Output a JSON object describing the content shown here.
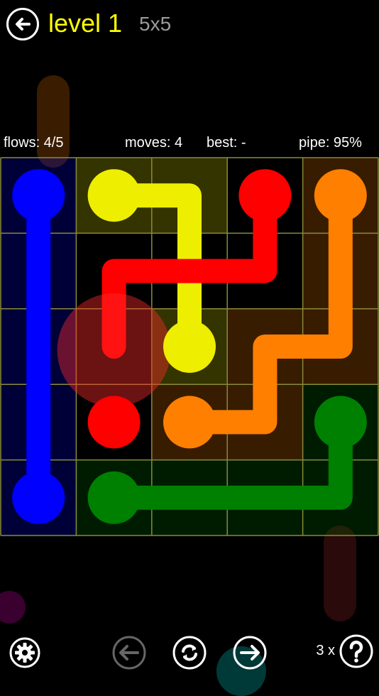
{
  "header": {
    "title": "level 1",
    "grid_size": "5x5"
  },
  "stats": {
    "flows": "flows: 4/5",
    "moves": "moves: 4",
    "best": "best: -",
    "pipe": "pipe: 95%"
  },
  "footer": {
    "hint_count": "3 x"
  },
  "colors": {
    "blue": "#0000ff",
    "yellow": "#eeee00",
    "red": "#ff0000",
    "orange": "#ff7f00",
    "green": "#008000",
    "grid_line": "#8a8a3a"
  },
  "board": {
    "rows": 5,
    "cols": 5,
    "endpoints": [
      {
        "color": "blue",
        "row": 0,
        "col": 0
      },
      {
        "color": "blue",
        "row": 4,
        "col": 0
      },
      {
        "color": "yellow",
        "row": 0,
        "col": 1
      },
      {
        "color": "yellow",
        "row": 2,
        "col": 2
      },
      {
        "color": "red",
        "row": 0,
        "col": 3
      },
      {
        "color": "red",
        "row": 3,
        "col": 1
      },
      {
        "color": "orange",
        "row": 0,
        "col": 4
      },
      {
        "color": "orange",
        "row": 3,
        "col": 2
      },
      {
        "color": "green",
        "row": 3,
        "col": 4
      },
      {
        "color": "green",
        "row": 4,
        "col": 1
      }
    ],
    "paths": [
      {
        "color": "blue",
        "cells": [
          [
            0,
            0
          ],
          [
            1,
            0
          ],
          [
            2,
            0
          ],
          [
            3,
            0
          ],
          [
            4,
            0
          ]
        ]
      },
      {
        "color": "yellow",
        "cells": [
          [
            0,
            1
          ],
          [
            0,
            2
          ],
          [
            1,
            2
          ],
          [
            2,
            2
          ]
        ]
      },
      {
        "color": "red",
        "cells": [
          [
            0,
            3
          ],
          [
            1,
            3
          ],
          [
            1,
            2
          ],
          [
            1,
            1
          ],
          [
            2,
            1
          ]
        ]
      },
      {
        "color": "orange",
        "cells": [
          [
            0,
            4
          ],
          [
            1,
            4
          ],
          [
            2,
            4
          ],
          [
            2,
            3
          ],
          [
            3,
            3
          ],
          [
            3,
            2
          ]
        ]
      },
      {
        "color": "green",
        "cells": [
          [
            3,
            4
          ],
          [
            4,
            4
          ],
          [
            4,
            3
          ],
          [
            4,
            2
          ],
          [
            4,
            1
          ]
        ]
      }
    ],
    "cell_tints": [
      [
        "blue",
        "yellow",
        "yellow",
        "none",
        "orange"
      ],
      [
        "blue",
        "none",
        "none",
        "none",
        "orange"
      ],
      [
        "blue",
        "none",
        "yellow",
        "orange",
        "orange"
      ],
      [
        "blue",
        "none",
        "orange",
        "orange",
        "green"
      ],
      [
        "blue",
        "green",
        "green",
        "green",
        "green"
      ]
    ]
  }
}
